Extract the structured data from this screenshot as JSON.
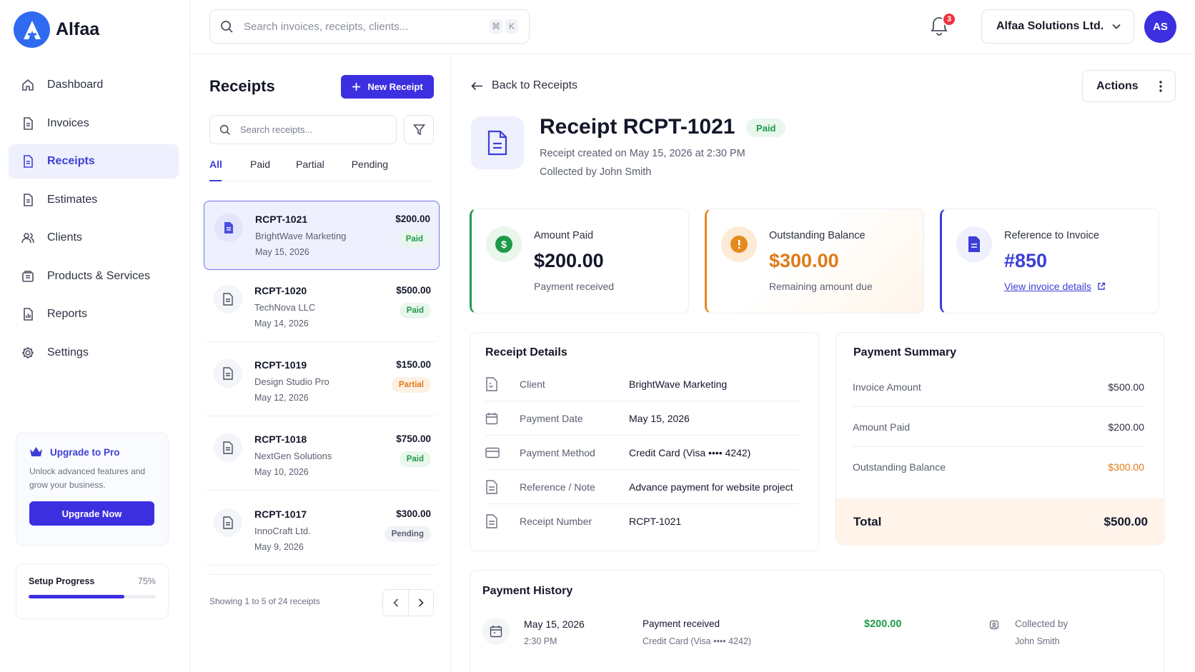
{
  "app": {
    "name": "Alfaa"
  },
  "sidebar": {
    "items": [
      {
        "label": "Dashboard",
        "icon": "home-icon"
      },
      {
        "label": "Invoices",
        "icon": "document-icon"
      },
      {
        "label": "Receipts",
        "icon": "receipt-icon",
        "active": true
      },
      {
        "label": "Estimates",
        "icon": "document-icon"
      },
      {
        "label": "Clients",
        "icon": "users-icon"
      },
      {
        "label": "Products & Services",
        "icon": "box-icon"
      },
      {
        "label": "Reports",
        "icon": "report-icon"
      },
      {
        "label": "Settings",
        "icon": "gear-icon"
      }
    ],
    "upgrade": {
      "title": "Upgrade to Pro",
      "desc": "Unlock advanced features and grow your business.",
      "button": "Upgrade Now"
    },
    "setup": {
      "label": "Setup Progress",
      "percent_label": "75%",
      "percent": 75
    }
  },
  "topbar": {
    "search_placeholder": "Search invoices, receipts, clients...",
    "kbd": [
      "⌘",
      "K"
    ],
    "notifications": "3",
    "company": "Alfaa Solutions Ltd.",
    "avatar": "AS"
  },
  "list": {
    "title": "Receipts",
    "new_button": "New Receipt",
    "search_placeholder": "Search receipts...",
    "tabs": [
      "All",
      "Paid",
      "Partial",
      "Pending"
    ],
    "items": [
      {
        "id": "RCPT-1021",
        "client": "BrightWave Marketing",
        "date": "May 15, 2026",
        "amount": "$200.00",
        "status": "Paid"
      },
      {
        "id": "RCPT-1020",
        "client": "TechNova LLC",
        "date": "May 14, 2026",
        "amount": "$500.00",
        "status": "Paid"
      },
      {
        "id": "RCPT-1019",
        "client": "Design Studio Pro",
        "date": "May 12, 2026",
        "amount": "$150.00",
        "status": "Partial"
      },
      {
        "id": "RCPT-1018",
        "client": "NextGen Solutions",
        "date": "May 10, 2026",
        "amount": "$750.00",
        "status": "Paid"
      },
      {
        "id": "RCPT-1017",
        "client": "InnoCraft Ltd.",
        "date": "May 9, 2026",
        "amount": "$300.00",
        "status": "Pending"
      }
    ],
    "showing": "Showing 1 to 5 of 24 receipts"
  },
  "detail": {
    "back": "Back to Receipts",
    "actions": "Actions",
    "title": "Receipt RCPT-1021",
    "status": "Paid",
    "created": "Receipt created on May 15, 2026 at 2:30 PM",
    "collected": "Collected by John Smith",
    "stats": {
      "paid": {
        "label": "Amount Paid",
        "value": "$200.00",
        "sub": "Payment received"
      },
      "outstanding": {
        "label": "Outstanding Balance",
        "value": "$300.00",
        "sub": "Remaining amount due"
      },
      "invoice": {
        "label": "Reference to Invoice",
        "value": "#850",
        "link": "View invoice details"
      }
    },
    "details": {
      "title": "Receipt Details",
      "rows": [
        {
          "label": "Client",
          "value": "BrightWave Marketing"
        },
        {
          "label": "Payment Date",
          "value": "May 15, 2026"
        },
        {
          "label": "Payment Method",
          "value": "Credit Card (Visa •••• 4242)"
        },
        {
          "label": "Reference / Note",
          "value": "Advance payment for website project"
        },
        {
          "label": "Receipt Number",
          "value": "RCPT-1021"
        }
      ]
    },
    "summary": {
      "title": "Payment Summary",
      "rows": [
        {
          "label": "Invoice Amount",
          "value": "$500.00"
        },
        {
          "label": "Amount Paid",
          "value": "$200.00"
        },
        {
          "label": "Outstanding Balance",
          "value": "$300.00"
        }
      ],
      "total_label": "Total",
      "total_value": "$500.00"
    },
    "history": {
      "title": "Payment History",
      "entry": {
        "date": "May 15, 2026",
        "time": "2:30 PM",
        "title": "Payment received",
        "method": "Credit Card (Visa •••• 4242)",
        "amount": "$200.00",
        "collected_label": "Collected by",
        "collected_name": "John Smith"
      }
    }
  },
  "colors": {
    "accent": "#3c2fe0",
    "green": "#1f9a4a",
    "orange": "#e07a16",
    "blue": "#3c3fd6"
  }
}
